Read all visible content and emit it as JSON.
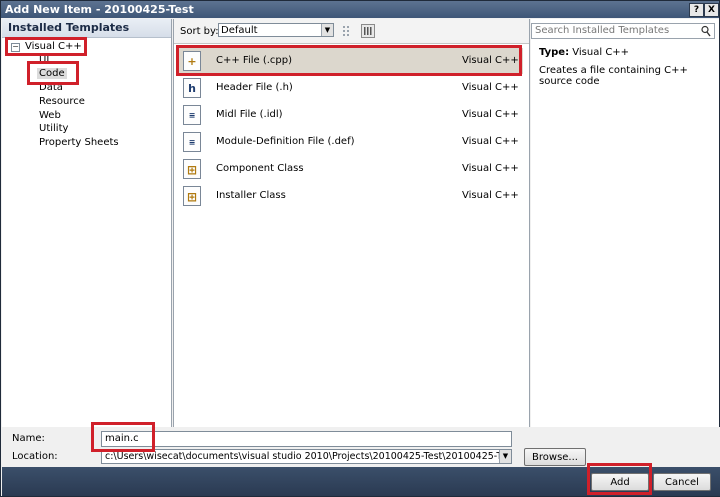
{
  "window": {
    "title": "Add New Item - 20100425-Test",
    "help_label": "?",
    "close_label": "X"
  },
  "left_pane": {
    "header": "Installed Templates",
    "tree_root": "Visual C++",
    "items": [
      "UI",
      "Code",
      "Data",
      "Resource",
      "Web",
      "Utility",
      "Property Sheets"
    ],
    "selected": "Code"
  },
  "toolbar": {
    "sort_label": "Sort by:",
    "sort_value": "Default"
  },
  "templates": [
    {
      "name": "C++ File (.cpp)",
      "language": "Visual C++",
      "icon": "cpp-file-icon"
    },
    {
      "name": "Header File (.h)",
      "language": "Visual C++",
      "icon": "header-file-icon"
    },
    {
      "name": "Midl File (.idl)",
      "language": "Visual C++",
      "icon": "midl-file-icon"
    },
    {
      "name": "Module-Definition File (.def)",
      "language": "Visual C++",
      "icon": "def-file-icon"
    },
    {
      "name": "Component Class",
      "language": "Visual C++",
      "icon": "component-class-icon"
    },
    {
      "name": "Installer Class",
      "language": "Visual C++",
      "icon": "installer-class-icon"
    }
  ],
  "details": {
    "search_placeholder": "Search Installed Templates",
    "type_label": "Type:",
    "type_value": "Visual C++",
    "description": "Creates a file containing C++ source code"
  },
  "form": {
    "name_label": "Name:",
    "name_value": "main.c",
    "location_label": "Location:",
    "location_value": "c:\\Users\\wisecat\\documents\\visual studio 2010\\Projects\\20100425-Test\\20100425-Te",
    "browse_label": "Browse...",
    "add_label": "Add",
    "cancel_label": "Cancel"
  },
  "colors": {
    "highlight": "#d0202a",
    "title_bar": "#4a6283",
    "selected_row": "#dcd7cd"
  }
}
